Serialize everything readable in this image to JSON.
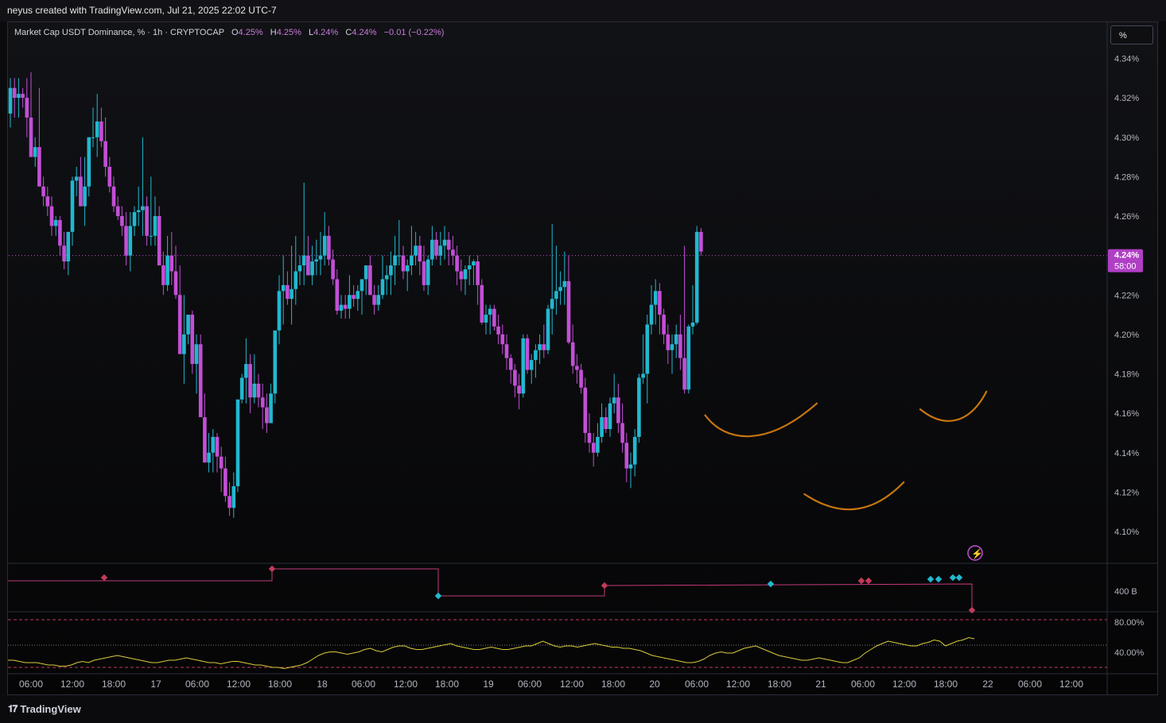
{
  "header": {
    "attribution": "neyus created with TradingView.com, Jul 21, 2025 22:02 UTC-7"
  },
  "legend": {
    "symbol": "Market Cap USDT Dominance, % · 1h · CRYPTOCAP",
    "open_label": "O",
    "open": "4.25%",
    "high_label": "H",
    "high": "4.25%",
    "low_label": "L",
    "low": "4.24%",
    "close_label": "C",
    "close": "4.24%",
    "change": "−0.01 (−0.22%)"
  },
  "scale_button": "%",
  "last_price": {
    "value": "4.24%",
    "countdown": "58:00"
  },
  "volume_label": "400 B",
  "footer": {
    "brand": "TradingView"
  },
  "colors": {
    "up": "#22b8cf",
    "down": "#c34fd6",
    "annotation": "#c8760f",
    "oscillator": "#d9cc3a",
    "band": "#c23a5a"
  },
  "chart_data": {
    "type": "candlestick",
    "timeframe": "1h",
    "ylim": [
      4.09,
      4.35
    ],
    "y_ticks": [
      "4.34%",
      "4.32%",
      "4.30%",
      "4.28%",
      "4.26%",
      "4.24%",
      "4.22%",
      "4.20%",
      "4.18%",
      "4.16%",
      "4.14%",
      "4.12%",
      "4.10%"
    ],
    "x_ticks": [
      "06:00",
      "12:00",
      "18:00",
      "17",
      "06:00",
      "12:00",
      "18:00",
      "18",
      "06:00",
      "12:00",
      "18:00",
      "19",
      "06:00",
      "12:00",
      "18:00",
      "20",
      "06:00",
      "12:00",
      "18:00",
      "21",
      "06:00",
      "12:00",
      "18:00",
      "22",
      "06:00",
      "12:00"
    ],
    "candles": [
      [
        4.312,
        4.33,
        4.305,
        4.325
      ],
      [
        4.325,
        4.33,
        4.31,
        4.32
      ],
      [
        4.32,
        4.33,
        4.31,
        4.322
      ],
      [
        4.322,
        4.325,
        4.315,
        4.32
      ],
      [
        4.32,
        4.33,
        4.3,
        4.31
      ],
      [
        4.31,
        4.333,
        4.29,
        4.29
      ],
      [
        4.29,
        4.3,
        4.285,
        4.295
      ],
      [
        4.295,
        4.325,
        4.28,
        4.275
      ],
      [
        4.275,
        4.28,
        4.265,
        4.27
      ],
      [
        4.27,
        4.275,
        4.26,
        4.265
      ],
      [
        4.265,
        4.27,
        4.25,
        4.255
      ],
      [
        4.255,
        4.26,
        4.25,
        4.258
      ],
      [
        4.258,
        4.26,
        4.24,
        4.245
      ],
      [
        4.245,
        4.252,
        4.233,
        4.237
      ],
      [
        4.237,
        4.25,
        4.23,
        4.252
      ],
      [
        4.252,
        4.28,
        4.245,
        4.278
      ],
      [
        4.278,
        4.285,
        4.27,
        4.28
      ],
      [
        4.28,
        4.29,
        4.265,
        4.265
      ],
      [
        4.265,
        4.29,
        4.255,
        4.275
      ],
      [
        4.275,
        4.3,
        4.27,
        4.3
      ],
      [
        4.3,
        4.315,
        4.295,
        4.3
      ],
      [
        4.3,
        4.322,
        4.29,
        4.308
      ],
      [
        4.308,
        4.315,
        4.295,
        4.298
      ],
      [
        4.298,
        4.31,
        4.28,
        4.285
      ],
      [
        4.285,
        4.29,
        4.272,
        4.275
      ],
      [
        4.275,
        4.28,
        4.262,
        4.265
      ],
      [
        4.265,
        4.27,
        4.258,
        4.26
      ],
      [
        4.26,
        4.265,
        4.25,
        4.255
      ],
      [
        4.255,
        4.262,
        4.235,
        4.24
      ],
      [
        4.24,
        4.262,
        4.232,
        4.255
      ],
      [
        4.255,
        4.265,
        4.25,
        4.262
      ],
      [
        4.262,
        4.275,
        4.255,
        4.263
      ],
      [
        4.263,
        4.3,
        4.25,
        4.265
      ],
      [
        4.265,
        4.27,
        4.245,
        4.25
      ],
      [
        4.25,
        4.28,
        4.245,
        4.25
      ],
      [
        4.25,
        4.27,
        4.245,
        4.26
      ],
      [
        4.26,
        4.265,
        4.235,
        4.235
      ],
      [
        4.235,
        4.242,
        4.22,
        4.225
      ],
      [
        4.225,
        4.25,
        4.222,
        4.24
      ],
      [
        4.24,
        4.252,
        4.225,
        4.232
      ],
      [
        4.232,
        4.245,
        4.218,
        4.22
      ],
      [
        4.22,
        4.235,
        4.2,
        4.19
      ],
      [
        4.19,
        4.22,
        4.175,
        4.2
      ],
      [
        4.2,
        4.21,
        4.195,
        4.21
      ],
      [
        4.21,
        4.212,
        4.18,
        4.185
      ],
      [
        4.185,
        4.2,
        4.17,
        4.195
      ],
      [
        4.195,
        4.2,
        4.17,
        4.158
      ],
      [
        4.158,
        4.17,
        4.145,
        4.135
      ],
      [
        4.135,
        4.15,
        4.13,
        4.14
      ],
      [
        4.14,
        4.152,
        4.13,
        4.148
      ],
      [
        4.148,
        4.15,
        4.13,
        4.138
      ],
      [
        4.138,
        4.143,
        4.12,
        4.132
      ],
      [
        4.132,
        4.138,
        4.115,
        4.118
      ],
      [
        4.118,
        4.125,
        4.108,
        4.112
      ],
      [
        4.112,
        4.13,
        4.107,
        4.123
      ],
      [
        4.123,
        4.165,
        4.12,
        4.167
      ],
      [
        4.167,
        4.18,
        4.165,
        4.178
      ],
      [
        4.178,
        4.198,
        4.165,
        4.185
      ],
      [
        4.185,
        4.19,
        4.16,
        4.168
      ],
      [
        4.168,
        4.19,
        4.165,
        4.175
      ],
      [
        4.175,
        4.18,
        4.163,
        4.168
      ],
      [
        4.168,
        4.175,
        4.152,
        4.163
      ],
      [
        4.163,
        4.17,
        4.15,
        4.155
      ],
      [
        4.155,
        4.175,
        4.155,
        4.17
      ],
      [
        4.17,
        4.2,
        4.165,
        4.202
      ],
      [
        4.202,
        4.23,
        4.195,
        4.222
      ],
      [
        4.222,
        4.24,
        4.205,
        4.225
      ],
      [
        4.225,
        4.232,
        4.215,
        4.218
      ],
      [
        4.218,
        4.245,
        4.205,
        4.223
      ],
      [
        4.223,
        4.25,
        4.215,
        4.232
      ],
      [
        4.232,
        4.24,
        4.225,
        4.235
      ],
      [
        4.235,
        4.277,
        4.225,
        4.24
      ],
      [
        4.24,
        4.25,
        4.23,
        4.23
      ],
      [
        4.23,
        4.245,
        4.225,
        4.237
      ],
      [
        4.237,
        4.248,
        4.23,
        4.238
      ],
      [
        4.238,
        4.252,
        4.23,
        4.24
      ],
      [
        4.24,
        4.262,
        4.235,
        4.25
      ],
      [
        4.25,
        4.255,
        4.235,
        4.238
      ],
      [
        4.238,
        4.243,
        4.225,
        4.228
      ],
      [
        4.228,
        4.233,
        4.21,
        4.212
      ],
      [
        4.212,
        4.22,
        4.208,
        4.215
      ],
      [
        4.215,
        4.22,
        4.208,
        4.213
      ],
      [
        4.213,
        4.23,
        4.208,
        4.22
      ],
      [
        4.22,
        4.225,
        4.214,
        4.218
      ],
      [
        4.218,
        4.225,
        4.212,
        4.222
      ],
      [
        4.222,
        4.225,
        4.21,
        4.228
      ],
      [
        4.228,
        4.232,
        4.22,
        4.235
      ],
      [
        4.235,
        4.24,
        4.22,
        4.22
      ],
      [
        4.22,
        4.225,
        4.21,
        4.215
      ],
      [
        4.215,
        4.225,
        4.212,
        4.22
      ],
      [
        4.22,
        4.24,
        4.218,
        4.228
      ],
      [
        4.228,
        4.235,
        4.22,
        4.23
      ],
      [
        4.23,
        4.242,
        4.22,
        4.235
      ],
      [
        4.235,
        4.25,
        4.225,
        4.24
      ],
      [
        4.24,
        4.258,
        4.235,
        4.24
      ],
      [
        4.24,
        4.245,
        4.228,
        4.232
      ],
      [
        4.232,
        4.238,
        4.222,
        4.235
      ],
      [
        4.235,
        4.255,
        4.23,
        4.24
      ],
      [
        4.24,
        4.252,
        4.235,
        4.245
      ],
      [
        4.245,
        4.25,
        4.23,
        4.237
      ],
      [
        4.237,
        4.245,
        4.222,
        4.225
      ],
      [
        4.225,
        4.24,
        4.22,
        4.238
      ],
      [
        4.238,
        4.255,
        4.235,
        4.248
      ],
      [
        4.248,
        4.252,
        4.238,
        4.24
      ],
      [
        4.24,
        4.252,
        4.235,
        4.245
      ],
      [
        4.245,
        4.255,
        4.238,
        4.248
      ],
      [
        4.248,
        4.252,
        4.235,
        4.243
      ],
      [
        4.243,
        4.25,
        4.235,
        4.24
      ],
      [
        4.24,
        4.245,
        4.225,
        4.232
      ],
      [
        4.232,
        4.238,
        4.222,
        4.228
      ],
      [
        4.228,
        4.235,
        4.22,
        4.233
      ],
      [
        4.233,
        4.24,
        4.225,
        4.235
      ],
      [
        4.235,
        4.238,
        4.225,
        4.237
      ],
      [
        4.237,
        4.24,
        4.215,
        4.225
      ],
      [
        4.225,
        4.228,
        4.205,
        4.206
      ],
      [
        4.206,
        4.215,
        4.2,
        4.21
      ],
      [
        4.21,
        4.215,
        4.2,
        4.213
      ],
      [
        4.213,
        4.215,
        4.202,
        4.204
      ],
      [
        4.204,
        4.21,
        4.195,
        4.2
      ],
      [
        4.2,
        4.205,
        4.19,
        4.195
      ],
      [
        4.195,
        4.2,
        4.182,
        4.188
      ],
      [
        4.188,
        4.19,
        4.175,
        4.182
      ],
      [
        4.182,
        4.185,
        4.168,
        4.174
      ],
      [
        4.174,
        4.18,
        4.162,
        4.17
      ],
      [
        4.17,
        4.2,
        4.168,
        4.198
      ],
      [
        4.198,
        4.2,
        4.18,
        4.182
      ],
      [
        4.182,
        4.19,
        4.175,
        4.187
      ],
      [
        4.187,
        4.195,
        4.178,
        4.192
      ],
      [
        4.192,
        4.2,
        4.185,
        4.195
      ],
      [
        4.195,
        4.205,
        4.188,
        4.192
      ],
      [
        4.192,
        4.215,
        4.19,
        4.213
      ],
      [
        4.213,
        4.256,
        4.2,
        4.218
      ],
      [
        4.218,
        4.245,
        4.21,
        4.222
      ],
      [
        4.222,
        4.232,
        4.215,
        4.224
      ],
      [
        4.224,
        4.242,
        4.215,
        4.227
      ],
      [
        4.227,
        4.24,
        4.195,
        4.196
      ],
      [
        4.196,
        4.205,
        4.18,
        4.184
      ],
      [
        4.184,
        4.19,
        4.175,
        4.182
      ],
      [
        4.182,
        4.185,
        4.17,
        4.173
      ],
      [
        4.173,
        4.178,
        4.145,
        4.15
      ],
      [
        4.15,
        4.16,
        4.14,
        4.145
      ],
      [
        4.145,
        4.15,
        4.133,
        4.14
      ],
      [
        4.14,
        4.155,
        4.138,
        4.148
      ],
      [
        4.148,
        4.165,
        4.145,
        4.158
      ],
      [
        4.158,
        4.163,
        4.15,
        4.152
      ],
      [
        4.152,
        4.168,
        4.148,
        4.165
      ],
      [
        4.165,
        4.18,
        4.16,
        4.168
      ],
      [
        4.168,
        4.175,
        4.15,
        4.155
      ],
      [
        4.155,
        4.165,
        4.14,
        4.145
      ],
      [
        4.145,
        4.15,
        4.125,
        4.132
      ],
      [
        4.132,
        4.14,
        4.122,
        4.134
      ],
      [
        4.134,
        4.152,
        4.128,
        4.148
      ],
      [
        4.148,
        4.18,
        4.145,
        4.178
      ],
      [
        4.178,
        4.2,
        4.175,
        4.18
      ],
      [
        4.18,
        4.21,
        4.165,
        4.205
      ],
      [
        4.205,
        4.225,
        4.2,
        4.215
      ],
      [
        4.215,
        4.228,
        4.205,
        4.222
      ],
      [
        4.222,
        4.226,
        4.2,
        4.21
      ],
      [
        4.21,
        4.213,
        4.195,
        4.2
      ],
      [
        4.2,
        4.205,
        4.185,
        4.192
      ],
      [
        4.192,
        4.2,
        4.18,
        4.195
      ],
      [
        4.195,
        4.205,
        4.188,
        4.2
      ],
      [
        4.2,
        4.21,
        4.182,
        4.188
      ],
      [
        4.188,
        4.245,
        4.17,
        4.172
      ],
      [
        4.172,
        4.205,
        4.17,
        4.204
      ],
      [
        4.204,
        4.225,
        4.2,
        4.206
      ],
      [
        4.206,
        4.255,
        4.205,
        4.252
      ],
      [
        4.252,
        4.254,
        4.24,
        4.242
      ]
    ],
    "annotations": [
      "curve",
      "curve",
      "curve"
    ],
    "oscillator": {
      "bands": [
        "80.00%",
        "40.00%"
      ],
      "values": [
        46,
        46,
        45,
        44,
        44,
        44,
        43,
        42,
        42,
        41,
        41,
        42,
        44,
        45,
        44,
        46,
        47,
        48,
        49,
        50,
        49,
        48,
        47,
        46,
        45,
        44,
        44,
        45,
        46,
        46,
        47,
        48,
        47,
        46,
        45,
        44,
        44,
        43,
        44,
        45,
        45,
        44,
        43,
        42,
        42,
        41,
        40,
        40,
        39,
        40,
        41,
        42,
        44,
        47,
        50,
        52,
        53,
        53,
        52,
        51,
        52,
        53,
        55,
        56,
        54,
        53,
        55,
        57,
        58,
        58,
        56,
        55,
        55,
        56,
        57,
        58,
        59,
        60,
        58,
        57,
        56,
        55,
        55,
        56,
        57,
        56,
        55,
        55,
        56,
        57,
        58,
        58,
        60,
        62,
        60,
        58,
        57,
        58,
        58,
        57,
        58,
        59,
        60,
        59,
        58,
        57,
        57,
        56,
        56,
        55,
        54,
        52,
        50,
        49,
        48,
        47,
        46,
        45,
        44,
        44,
        45,
        47,
        50,
        52,
        53,
        52,
        52,
        54,
        56,
        57,
        58,
        56,
        54,
        52,
        50,
        49,
        48,
        47,
        46,
        46,
        47,
        48,
        47,
        46,
        45,
        44,
        44,
        46,
        48,
        52,
        55,
        58,
        60,
        62,
        61,
        60,
        59,
        58,
        58,
        60,
        61,
        63,
        62,
        58,
        60,
        62,
        63,
        65,
        64
      ]
    },
    "volume_profile": {
      "label": "400 B"
    }
  }
}
